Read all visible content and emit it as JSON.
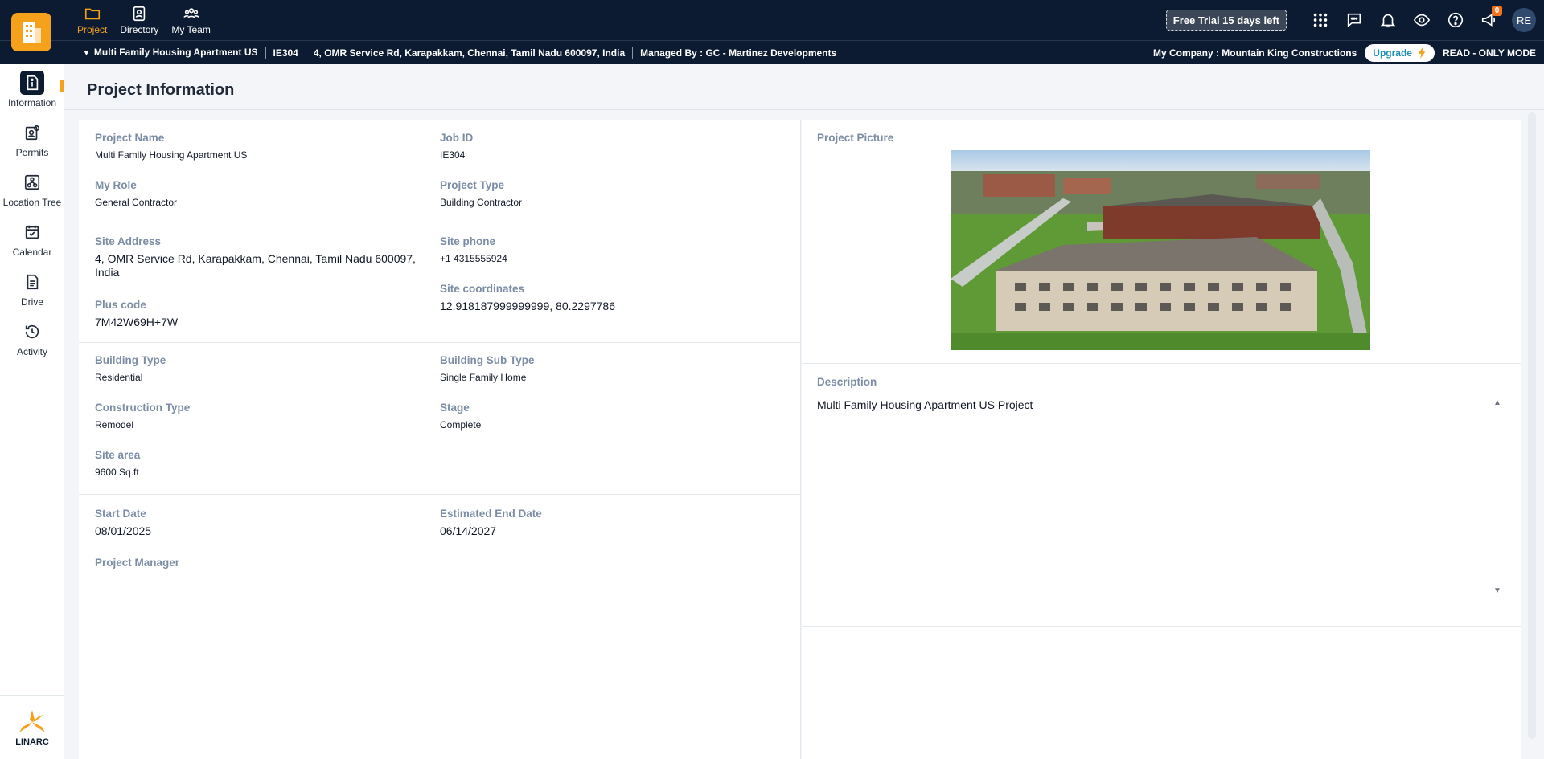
{
  "nav": {
    "items": [
      {
        "label": "Project",
        "icon": "folder-icon"
      },
      {
        "label": "Directory",
        "icon": "contact-book-icon"
      },
      {
        "label": "My Team",
        "icon": "team-icon"
      }
    ]
  },
  "header": {
    "trial_label": "Free Trial 15 days left",
    "announcement_count": "0",
    "avatar_initials": "RE"
  },
  "subheader": {
    "project_name": "Multi Family Housing Apartment US",
    "job_id": "IE304",
    "address": "4, OMR Service Rd, Karapakkam, Chennai, Tamil Nadu 600097, India",
    "managed_by": "Managed By : GC - Martinez Developments",
    "company": "My Company : Mountain King Constructions",
    "upgrade_label": "Upgrade",
    "mode": "READ - ONLY MODE"
  },
  "sidebar": {
    "items": [
      {
        "label": "Information",
        "icon": "info-document-icon"
      },
      {
        "label": "Permits",
        "icon": "permit-icon"
      },
      {
        "label": "Location Tree",
        "icon": "location-tree-icon"
      },
      {
        "label": "Calendar",
        "icon": "calendar-icon"
      },
      {
        "label": "Drive",
        "icon": "drive-icon"
      },
      {
        "label": "Activity",
        "icon": "history-icon"
      }
    ],
    "brand": "LINARC"
  },
  "page": {
    "title": "Project Information"
  },
  "info": {
    "project_name": {
      "label": "Project Name",
      "value": "Multi Family Housing Apartment US"
    },
    "job_id": {
      "label": "Job ID",
      "value": "IE304"
    },
    "my_role": {
      "label": "My Role",
      "value": "General Contractor"
    },
    "project_type": {
      "label": "Project Type",
      "value": "Building Contractor"
    },
    "site_address": {
      "label": "Site Address",
      "value": "4, OMR Service Rd, Karapakkam, Chennai, Tamil Nadu 600097, India"
    },
    "site_phone": {
      "label": "Site phone",
      "value": "+1 4315555924"
    },
    "site_coordinates": {
      "label": "Site coordinates",
      "value": "12.918187999999999, 80.2297786"
    },
    "plus_code": {
      "label": "Plus code",
      "value": "7M42W69H+7W"
    },
    "building_type": {
      "label": "Building Type",
      "value": "Residential"
    },
    "building_sub_type": {
      "label": "Building Sub Type",
      "value": "Single Family Home"
    },
    "construction_type": {
      "label": "Construction Type",
      "value": "Remodel"
    },
    "stage": {
      "label": "Stage",
      "value": "Complete"
    },
    "site_area": {
      "label": "Site area",
      "value": "9600 Sq.ft"
    },
    "start_date": {
      "label": "Start Date",
      "value": "08/01/2025"
    },
    "estimated_end_date": {
      "label": "Estimated End Date",
      "value": "06/14/2027"
    },
    "project_manager": {
      "label": "Project Manager",
      "value": ""
    }
  },
  "right_panel": {
    "picture_label": "Project Picture",
    "description_label": "Description",
    "description_text": "Multi Family Housing Apartment US Project"
  },
  "colors": {
    "header_bg": "#0c1b31",
    "accent": "#f5a11c",
    "label": "#7b8ca4"
  }
}
